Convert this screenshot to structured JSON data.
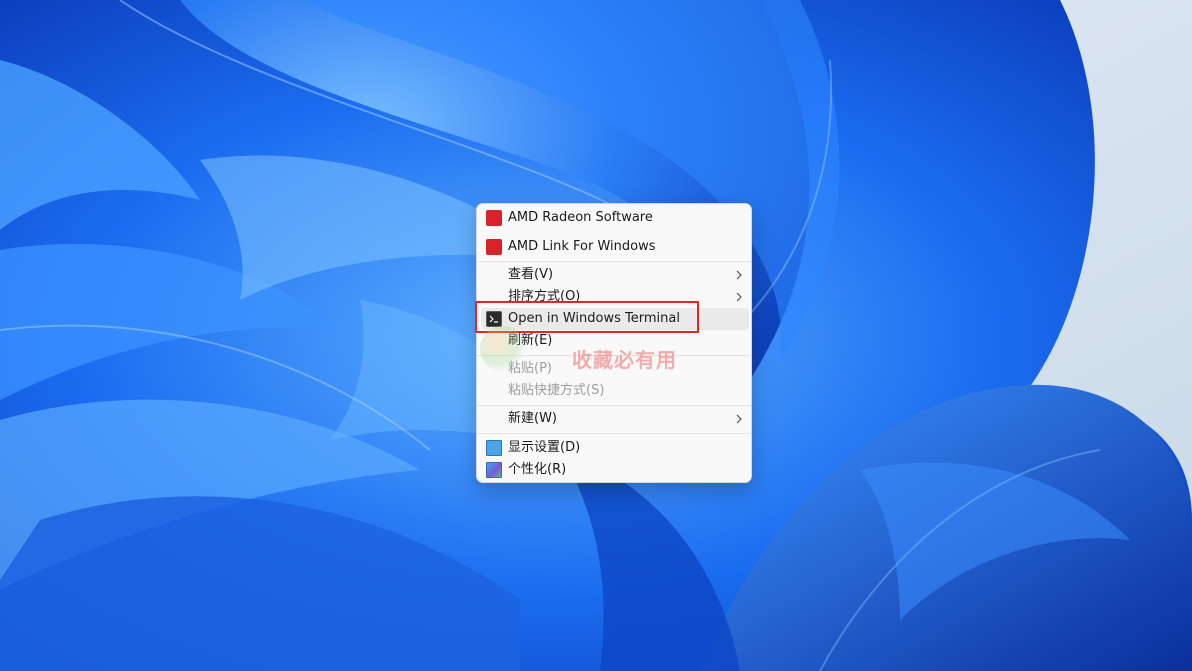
{
  "desktop": {
    "wallpaper": "windows-11-bloom",
    "colors": {
      "background": "#d9e4ef",
      "bloom_deep": "#0a3bb8",
      "bloom_mid": "#1b6cf0",
      "bloom_light": "#4fa3ff"
    }
  },
  "context_menu": {
    "items": [
      {
        "label": "AMD Radeon Software",
        "icon": "amd-icon",
        "enabled": true,
        "submenu": false
      },
      {
        "label": "AMD Link For Windows",
        "icon": "amd-icon",
        "enabled": true,
        "submenu": false
      },
      {
        "label": "查看(V)",
        "icon": "",
        "enabled": true,
        "submenu": true
      },
      {
        "label": "排序方式(O)",
        "icon": "",
        "enabled": true,
        "submenu": true
      },
      {
        "label": "Open in Windows Terminal",
        "icon": "terminal-icon",
        "enabled": true,
        "submenu": false,
        "hovered": true
      },
      {
        "label": "刷新(E)",
        "icon": "",
        "enabled": true,
        "submenu": false
      },
      {
        "label": "粘贴(P)",
        "icon": "",
        "enabled": false,
        "submenu": false
      },
      {
        "label": "粘贴快捷方式(S)",
        "icon": "",
        "enabled": false,
        "submenu": false
      },
      {
        "label": "新建(W)",
        "icon": "",
        "enabled": true,
        "submenu": true
      },
      {
        "label": "显示设置(D)",
        "icon": "monitor-icon",
        "enabled": true,
        "submenu": false
      },
      {
        "label": "个性化(R)",
        "icon": "personalize-icon",
        "enabled": true,
        "submenu": false
      }
    ]
  },
  "annotation": {
    "highlight_color": "#e02626",
    "highlighted_item": "Open in Windows Terminal"
  },
  "watermark": {
    "text": "收藏必有用",
    "color": "#ee6e6e"
  }
}
